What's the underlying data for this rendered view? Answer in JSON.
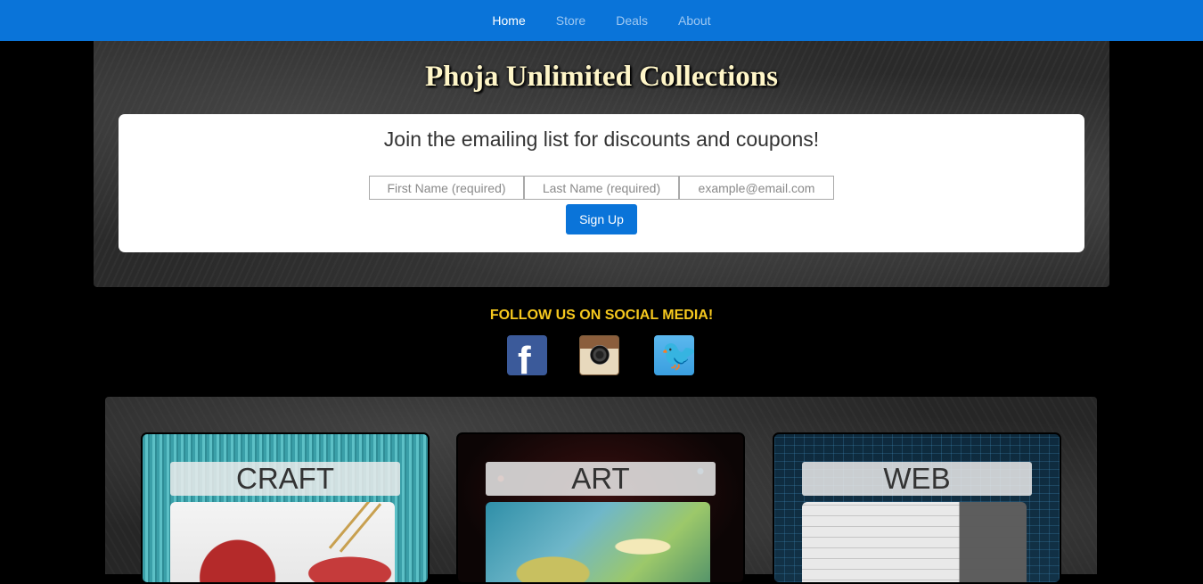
{
  "nav": {
    "items": [
      {
        "label": "Home",
        "active": true
      },
      {
        "label": "Store",
        "active": false
      },
      {
        "label": "Deals",
        "active": false
      },
      {
        "label": "About",
        "active": false
      }
    ]
  },
  "hero": {
    "title": "Phoja Unlimited Collections",
    "signup": {
      "heading": "Join the emailing list for discounts and coupons!",
      "first_name_placeholder": "First Name (required)",
      "last_name_placeholder": "Last Name (required)",
      "email_placeholder": "example@email.com",
      "button_label": "Sign Up"
    }
  },
  "social": {
    "heading": "FOLLOW US ON SOCIAL MEDIA!",
    "icons": [
      "facebook-icon",
      "instagram-icon",
      "twitter-icon"
    ]
  },
  "categories": [
    {
      "label": "CRAFT"
    },
    {
      "label": "ART"
    },
    {
      "label": "WEB"
    }
  ],
  "colors": {
    "nav_bg": "#0a74d9",
    "accent_yellow": "#f6c81e",
    "button_bg": "#0a74d9"
  }
}
